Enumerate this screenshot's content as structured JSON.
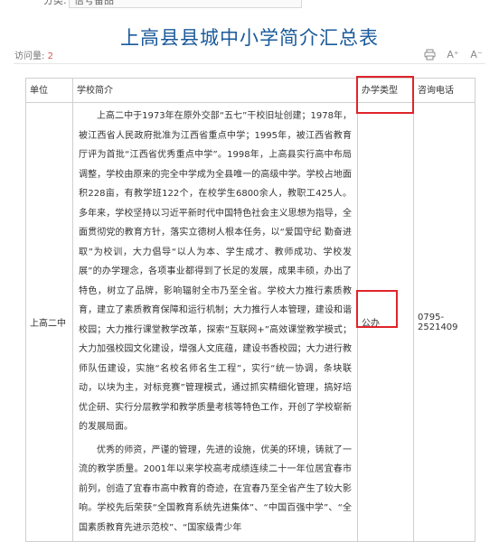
{
  "breadcrumb": {
    "label": "分类:",
    "value": "信号备品"
  },
  "page_title": "上高县县城中小学简介汇总表",
  "visits": {
    "label": "访问量:",
    "count": "2"
  },
  "toolbar": {
    "icons": [
      "print-icon",
      "font-larger-icon",
      "font-smaller-icon"
    ],
    "larger_label": "A⁺",
    "smaller_label": "A⁻"
  },
  "table": {
    "headers": [
      "单位",
      "学校简介",
      "办学类型",
      "咨询电话"
    ],
    "rows": [
      {
        "unit": "上高二中",
        "intro": [
          "上高二中于1973年在原外交部“五七”干校旧址创建；1978年，被江西省人民政府批准为江西省重点中学；1995年，被江西省教育厅评为首批“江西省优秀重点中学”。1998年，上高县实行高中布局调整，学校由原来的完全中学成为全县唯一的高级中学。学校占地面积228亩，有教学班122个，在校学生6800余人，教职工425人。多年来，学校坚持以习近平新时代中国特色社会主义思想为指导，全面贯彻党的教育方针，落实立德树人根本任务，以“爱国守纪  勤奋进取”为校训，大力倡导“以人为本、学生成才、教师成功、学校发展”的办学理念，各项事业都得到了长足的发展，成果丰硕，办出了特色，树立了品牌，影响辐射全市乃至全省。学校大力推行素质教育，建立了素质教育保障和运行机制；大力推行人本管理，建设和谐校园；大力推行课堂教学改革，探索“互联网+”高效课堂教学模式；大力加强校园文化建设，增强人文底蕴，建设书香校园；大力进行教师队伍建设，实施“名校名师名生工程”，实行“统一协调，条块联动，以块为主，对标竞赛”管理模式，通过抓实精细化管理，搞好培优企研、实行分层教学和教学质量考核等特色工作，开创了学校崭新的发展局面。",
          "优秀的师资，严谨的管理，先进的设施，优美的环境，铸就了一流的教学质量。2001年以来学校高考成绩连续二十一年位居宜春市前列，创造了宜春市高中教育的奇迹，在宜春乃至全省产生了较大影响。学校先后荣获“全国教育系统先进集体”、“中国百强中学”、“全国素质教育先进示范校”、“国家级青少年"
        ],
        "type": "公办",
        "phone": "0795-2521409"
      }
    ]
  },
  "colors": {
    "title": "#1a5a9a",
    "highlight": "#e0242a",
    "visit_count": "#d9534f"
  }
}
